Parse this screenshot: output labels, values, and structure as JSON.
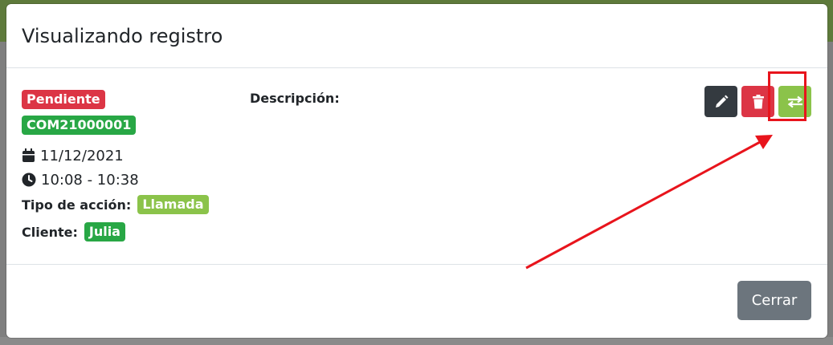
{
  "modal": {
    "title": "Visualizando registro",
    "status_badge": "Pendiente",
    "code_badge": "COM21000001",
    "date": "11/12/2021",
    "time": "10:08 - 10:38",
    "action_type_label": "Tipo de acción:",
    "action_type_value": "Llamada",
    "client_label": "Cliente:",
    "client_value": "Julia",
    "description_label": "Descripción:",
    "close_button": "Cerrar"
  },
  "icons": {
    "date": "calendar-icon",
    "time": "clock-icon",
    "edit": "pencil-icon",
    "delete": "trash-icon",
    "transfer": "exchange-arrows-icon"
  },
  "colors": {
    "status_pending": "#dc3545",
    "code": "#28a745",
    "action_type": "#8bc34a",
    "client": "#28a745",
    "edit_button": "#343a40",
    "delete_button": "#dc3545",
    "transfer_button": "#8bc34a",
    "close_button": "#6c757d",
    "annotation": "#e8141c"
  }
}
